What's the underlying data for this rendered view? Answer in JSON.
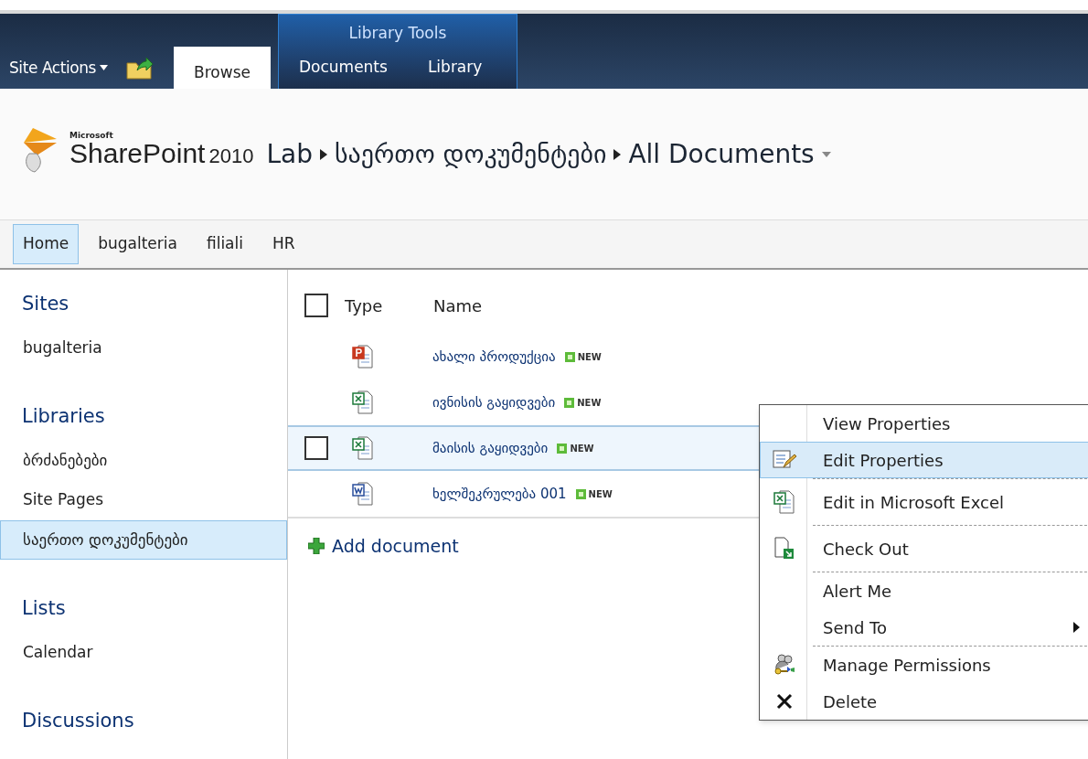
{
  "ribbon": {
    "site_actions": "Site Actions",
    "tool_group": "Library Tools",
    "tabs": [
      {
        "label": "Browse",
        "selected": true
      }
    ],
    "tool_tabs": [
      {
        "label": "Documents",
        "selected": false
      },
      {
        "label": "Library",
        "selected": false
      }
    ]
  },
  "header": {
    "logo_small": "Microsoft",
    "logo": "SharePoint",
    "logo_version": "2010",
    "breadcrumb": [
      "Lab",
      "საერთო დოკუმენტები",
      "All Documents"
    ]
  },
  "top_nav": [
    {
      "label": "Home",
      "selected": true
    },
    {
      "label": "bugalteria",
      "selected": false
    },
    {
      "label": "filiali",
      "selected": false
    },
    {
      "label": "HR",
      "selected": false
    }
  ],
  "sidebar": [
    {
      "heading": "Sites",
      "items": [
        {
          "label": "bugalteria",
          "selected": false
        }
      ]
    },
    {
      "heading": "Libraries",
      "items": [
        {
          "label": "ბრძანებები",
          "selected": false
        },
        {
          "label": "Site Pages",
          "selected": false
        },
        {
          "label": "საერთო დოკუმენტები",
          "selected": true
        }
      ]
    },
    {
      "heading": "Lists",
      "items": [
        {
          "label": "Calendar",
          "selected": false
        }
      ]
    },
    {
      "heading": "Discussions"
    }
  ],
  "table": {
    "select_all": {
      "checked": false
    },
    "columns": [
      "Type",
      "Name"
    ],
    "rows": [
      {
        "kind": "ppt",
        "name": "ახალი პროდუქცია",
        "badge": "NEW",
        "selected": false
      },
      {
        "kind": "xls",
        "name": "ივნისის გაყიდვები",
        "badge": "NEW",
        "selected": false
      },
      {
        "kind": "xls",
        "name": "მაისის გაყიდვები",
        "badge": "NEW",
        "selected": true
      },
      {
        "kind": "doc",
        "name": "ხელშეკრულება 001",
        "badge": "NEW",
        "selected": false
      }
    ],
    "add": "Add document"
  },
  "context_menu": [
    [
      {
        "kind": "plain",
        "label": "View Properties",
        "selected": false
      },
      {
        "kind": "edit",
        "label": "Edit Properties",
        "selected": true
      }
    ],
    [
      {
        "kind": "excel",
        "label": "Edit in Microsoft Excel",
        "selected": false
      }
    ],
    [
      {
        "kind": "checkout",
        "label": "Check Out",
        "selected": false
      }
    ],
    [
      {
        "kind": "plain",
        "label": "Alert Me",
        "selected": false
      },
      {
        "kind": "submenu",
        "label": "Send To",
        "selected": false
      }
    ],
    [
      {
        "kind": "permissions",
        "label": "Manage Permissions",
        "selected": false
      },
      {
        "kind": "delete",
        "label": "Delete",
        "selected": false
      }
    ]
  ]
}
